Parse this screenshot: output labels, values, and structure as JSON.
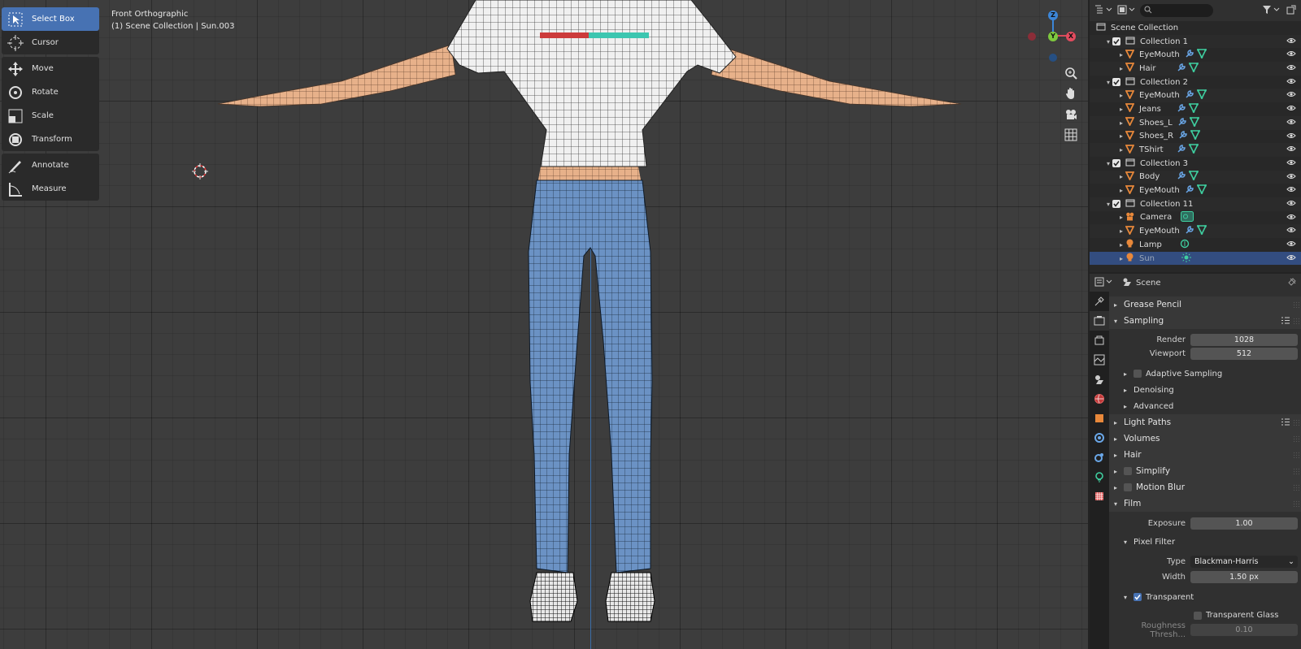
{
  "viewport": {
    "view_name": "Front Orthographic",
    "context": "(1) Scene Collection | Sun.003",
    "gizmo": {
      "z": "Z",
      "y": "Y",
      "x": "X"
    }
  },
  "toolbar": {
    "tools": [
      {
        "label": "Select Box",
        "icon": "select-box-icon",
        "active": true
      },
      {
        "label": "Cursor",
        "icon": "cursor-icon"
      },
      {
        "label": "Move",
        "icon": "move-icon"
      },
      {
        "label": "Rotate",
        "icon": "rotate-icon"
      },
      {
        "label": "Scale",
        "icon": "scale-icon"
      },
      {
        "label": "Transform",
        "icon": "transform-icon"
      },
      {
        "label": "Annotate",
        "icon": "annotate-icon"
      },
      {
        "label": "Measure",
        "icon": "measure-icon"
      }
    ]
  },
  "outliner": {
    "root": "Scene Collection",
    "rows": [
      {
        "label": "Collection 1",
        "kind": "collection"
      },
      {
        "label": "EyeMouth",
        "kind": "mesh",
        "mods": 2
      },
      {
        "label": "Hair",
        "kind": "mesh",
        "mods": 2
      },
      {
        "label": "Collection 2",
        "kind": "collection"
      },
      {
        "label": "EyeMouth",
        "kind": "mesh",
        "mods": 2
      },
      {
        "label": "Jeans",
        "kind": "mesh",
        "mods": 2
      },
      {
        "label": "Shoes_L",
        "kind": "mesh",
        "mods": 2
      },
      {
        "label": "Shoes_R",
        "kind": "mesh",
        "mods": 2
      },
      {
        "label": "TShirt",
        "kind": "mesh",
        "mods": 2
      },
      {
        "label": "Collection 3",
        "kind": "collection"
      },
      {
        "label": "Body",
        "kind": "mesh",
        "mods": 2
      },
      {
        "label": "EyeMouth",
        "kind": "mesh",
        "mods": 2
      },
      {
        "label": "Collection 11",
        "kind": "collection"
      },
      {
        "label": "Camera",
        "kind": "camera"
      },
      {
        "label": "EyeMouth",
        "kind": "mesh",
        "mods": 2
      },
      {
        "label": "Lamp",
        "kind": "light"
      },
      {
        "label": "Sun",
        "kind": "sun",
        "selected": true
      }
    ],
    "colors": {
      "mesh": "#e8883a",
      "modifier": "#6aa7e8",
      "data": "#3fcfa0",
      "selected": "#334d80"
    }
  },
  "properties": {
    "context": "Scene",
    "panels": {
      "grease_pencil": "Grease Pencil",
      "sampling": "Sampling",
      "render_label": "Render",
      "render_value": "1028",
      "viewport_label": "Viewport",
      "viewport_value": "512",
      "adaptive_sampling": "Adaptive Sampling",
      "denoising": "Denoising",
      "advanced": "Advanced",
      "light_paths": "Light Paths",
      "volumes": "Volumes",
      "hair": "Hair",
      "simplify": "Simplify",
      "motion_blur": "Motion Blur",
      "film": "Film",
      "exposure_label": "Exposure",
      "exposure_value": "1.00",
      "pixel_filter": "Pixel Filter",
      "type_label": "Type",
      "type_value": "Blackman-Harris",
      "width_label": "Width",
      "width_value": "1.50 px",
      "transparent": "Transparent",
      "transparent_glass": "Transparent Glass",
      "roughness_label": "Roughness Thresh...",
      "roughness_value": "0.10"
    }
  }
}
